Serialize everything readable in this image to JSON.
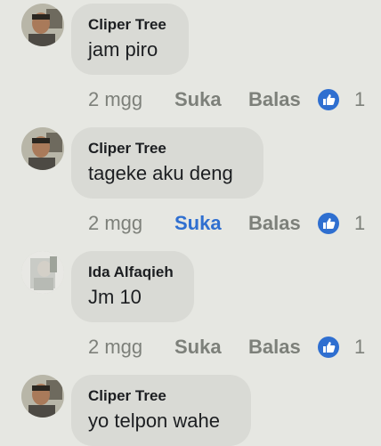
{
  "comments": [
    {
      "author": "Cliper Tree",
      "text": "jam piro",
      "time": "2 mgg",
      "like_label": "Suka",
      "reply_label": "Balas",
      "reactions": "1",
      "liked": false
    },
    {
      "author": "Cliper Tree",
      "text": "tageke aku deng",
      "time": "2 mgg",
      "like_label": "Suka",
      "reply_label": "Balas",
      "reactions": "1",
      "liked": true
    },
    {
      "author": "Ida Alfaqieh",
      "text": "Jm 10",
      "time": "2 mgg",
      "like_label": "Suka",
      "reply_label": "Balas",
      "reactions": "1",
      "liked": false
    },
    {
      "author": "Cliper Tree",
      "text": "yo telpon wahe",
      "time": null,
      "like_label": null,
      "reply_label": null,
      "reactions": null,
      "liked": false
    }
  ],
  "colors": {
    "background": "#e6e7e2",
    "bubble": "#d9dad5",
    "liked_accent": "#2f6fd0",
    "reaction_icon": "#2f6fd0",
    "muted_text": "#7d807a"
  },
  "icons": {
    "reaction": "thumbs-up-icon"
  }
}
